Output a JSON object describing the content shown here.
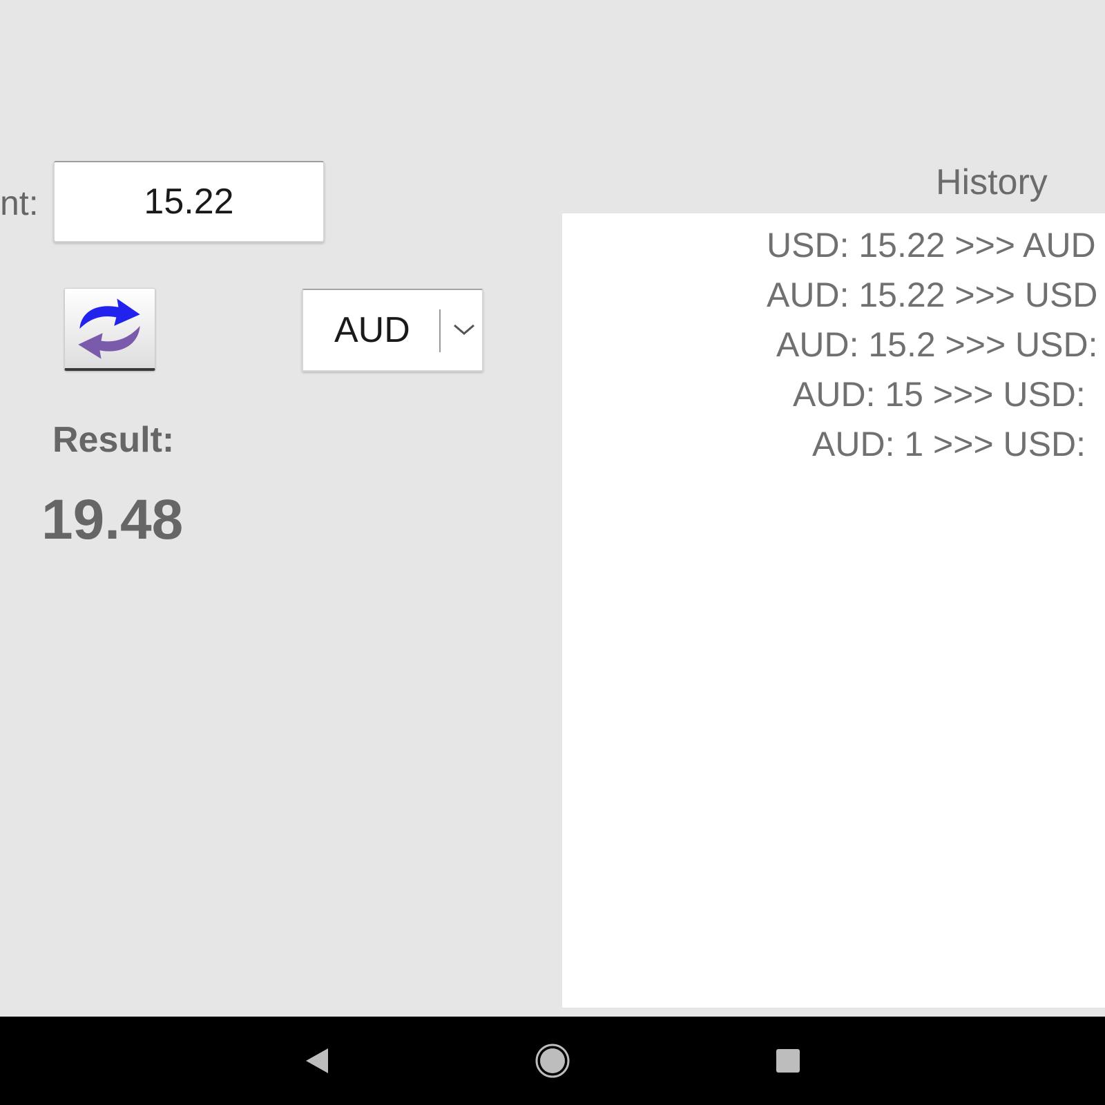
{
  "converter": {
    "amount_label": "nt:",
    "amount_value": "15.22",
    "currency_selected": "AUD",
    "result_label": "Result:",
    "result_value": "19.48"
  },
  "history": {
    "title": "History",
    "items": [
      "USD: 15.22  >>>  AUD",
      "AUD: 15.22  >>>  USD",
      "AUD: 15.2  >>>  USD:",
      "AUD: 15  >>>  USD:",
      "AUD: 1  >>>  USD:"
    ]
  },
  "icons": {
    "swap": "swap-arrows-icon",
    "dropdown": "chevron-down-icon",
    "back": "back-triangle-icon",
    "home": "home-circle-icon",
    "recents": "recents-square-icon"
  },
  "colors": {
    "background": "#e6e6e6",
    "panel": "#ffffff",
    "text_gray": "#666666",
    "arrow_blue": "#2222ee",
    "arrow_purple": "#7a5bab",
    "nav_bar": "#000000",
    "nav_icon": "#bdbdbd"
  }
}
